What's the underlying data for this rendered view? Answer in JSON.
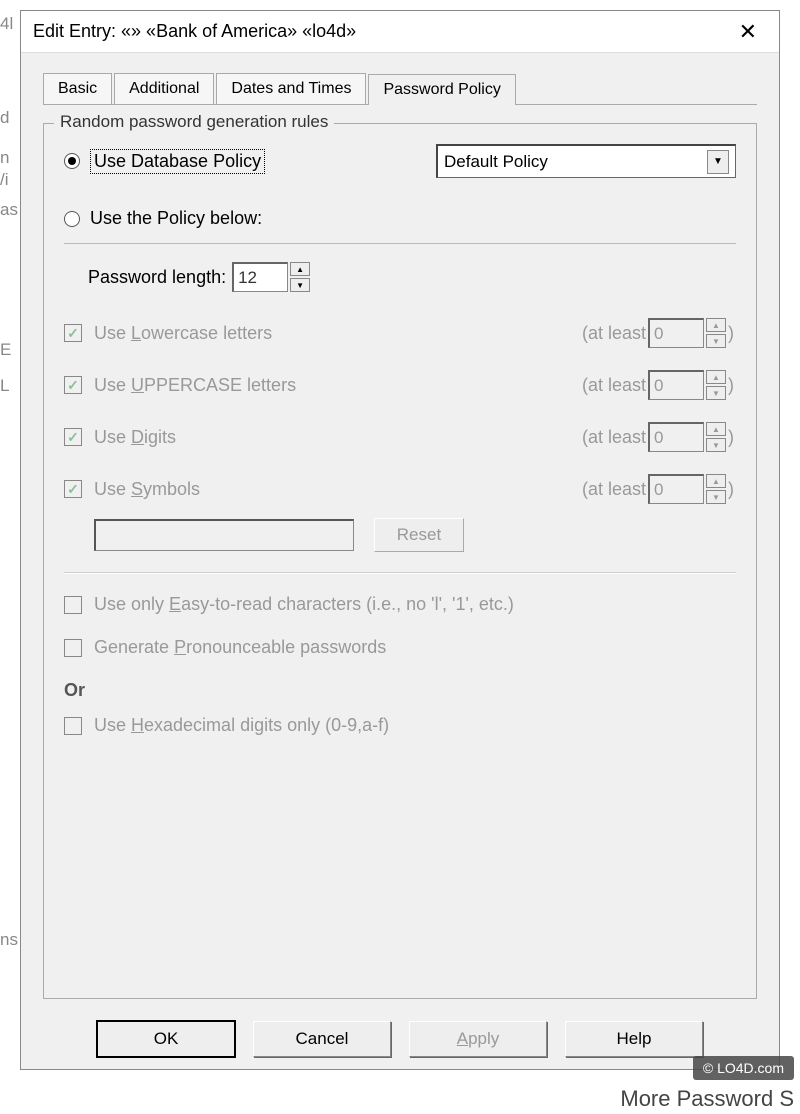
{
  "title": "Edit Entry:   «» «Bank of America» «lo4d»",
  "tabs": {
    "basic": "Basic",
    "additional": "Additional",
    "dates": "Dates and Times",
    "policy": "Password Policy"
  },
  "group_legend": "Random password generation rules",
  "radio": {
    "db": "Use Database Policy",
    "below": "Use the Policy below:"
  },
  "combo_value": "Default Policy",
  "len": {
    "label_pre": "Password len",
    "label_u": "g",
    "label_post": "th:",
    "value": "12"
  },
  "rule": {
    "lower_pre": "Use ",
    "lower_u": "L",
    "lower_post": "owercase letters",
    "upper_pre": "Use ",
    "upper_u": "U",
    "upper_post": "PPERCASE letters",
    "digits_pre": "Use ",
    "digits_u": "D",
    "digits_post": "igits",
    "symbols_pre": "Use ",
    "symbols_u": "S",
    "symbols_post": "ymbols",
    "atleast_pre": "(at least",
    "atleast_val": "0",
    "atleast_post": ")"
  },
  "reset": "Reset",
  "easy_pre": "Use only ",
  "easy_u": "E",
  "easy_post": "asy-to-read characters (i.e., no  'l', '1', etc.)",
  "pron_pre": "Generate ",
  "pron_u": "P",
  "pron_post": "ronounceable passwords",
  "or": "Or",
  "hex_pre": "Use ",
  "hex_u": "H",
  "hex_post": "exadecimal digits only (0-9,a-f)",
  "buttons": {
    "ok": "OK",
    "cancel": "Cancel",
    "apply_u": "A",
    "apply_post": "pply",
    "help": "Help"
  },
  "watermark": "© LO4D.com",
  "more": "More Password S",
  "bg": {
    "l1": "4l",
    "l2": "n",
    "l3": "as",
    "l4": "E",
    "l5": "L",
    "l6": "ns",
    "l7": "d",
    "l8": "/i"
  }
}
